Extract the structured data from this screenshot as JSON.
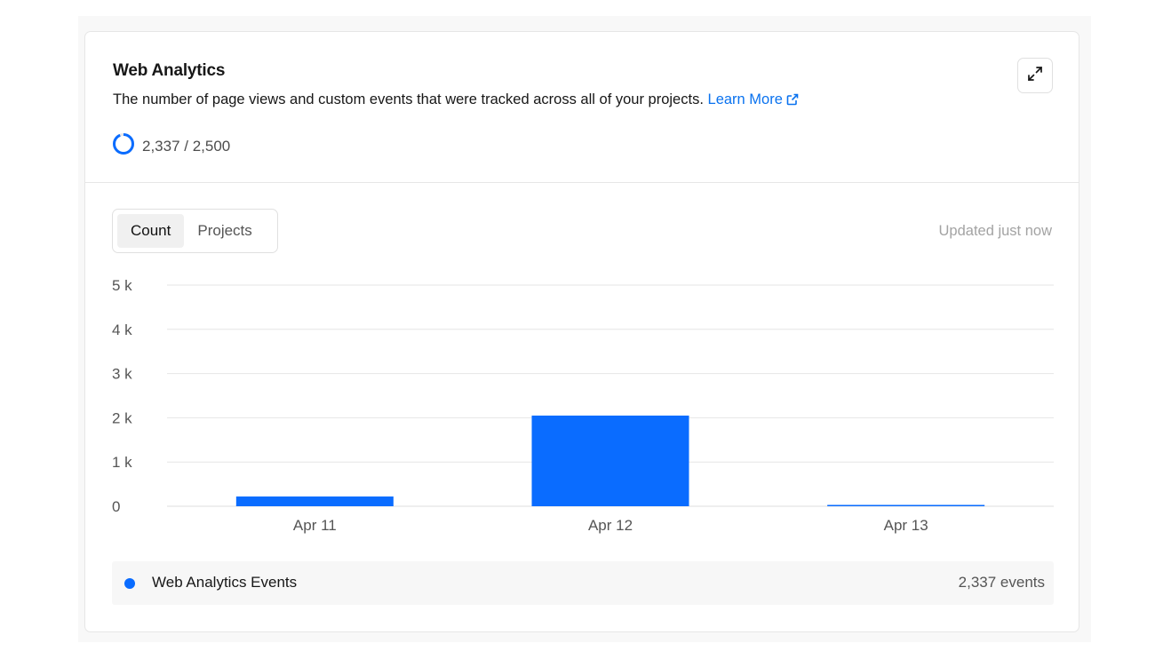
{
  "card": {
    "title": "Web Analytics",
    "description": "The number of page views and custom events that were tracked across all of your projects.",
    "learn_more": "Learn More",
    "usage_text": "2,337 / 2,500",
    "usage_used": 2337,
    "usage_limit": 2500
  },
  "tabs": [
    {
      "label": "Count",
      "active": true
    },
    {
      "label": "Projects",
      "active": false
    }
  ],
  "updated": "Updated just now",
  "icons": {
    "expand": "expand-icon",
    "external": "external-link-icon",
    "usage": "usage-ring-icon"
  },
  "colors": {
    "accent": "#0a6cff",
    "link": "#0a72ef",
    "grid": "#e6e6e6"
  },
  "chart_data": {
    "type": "bar",
    "categories": [
      "Apr 11",
      "Apr 12",
      "Apr 13"
    ],
    "series": [
      {
        "name": "Web Analytics Events",
        "values": [
          220,
          2050,
          20
        ]
      }
    ],
    "yticks": [
      "0",
      "1 k",
      "2 k",
      "3 k",
      "4 k",
      "5 k"
    ],
    "ylim": [
      0,
      5000
    ],
    "grid": true,
    "legend": "bottom"
  },
  "legend": {
    "label": "Web Analytics Events",
    "value": "2,337 events"
  }
}
